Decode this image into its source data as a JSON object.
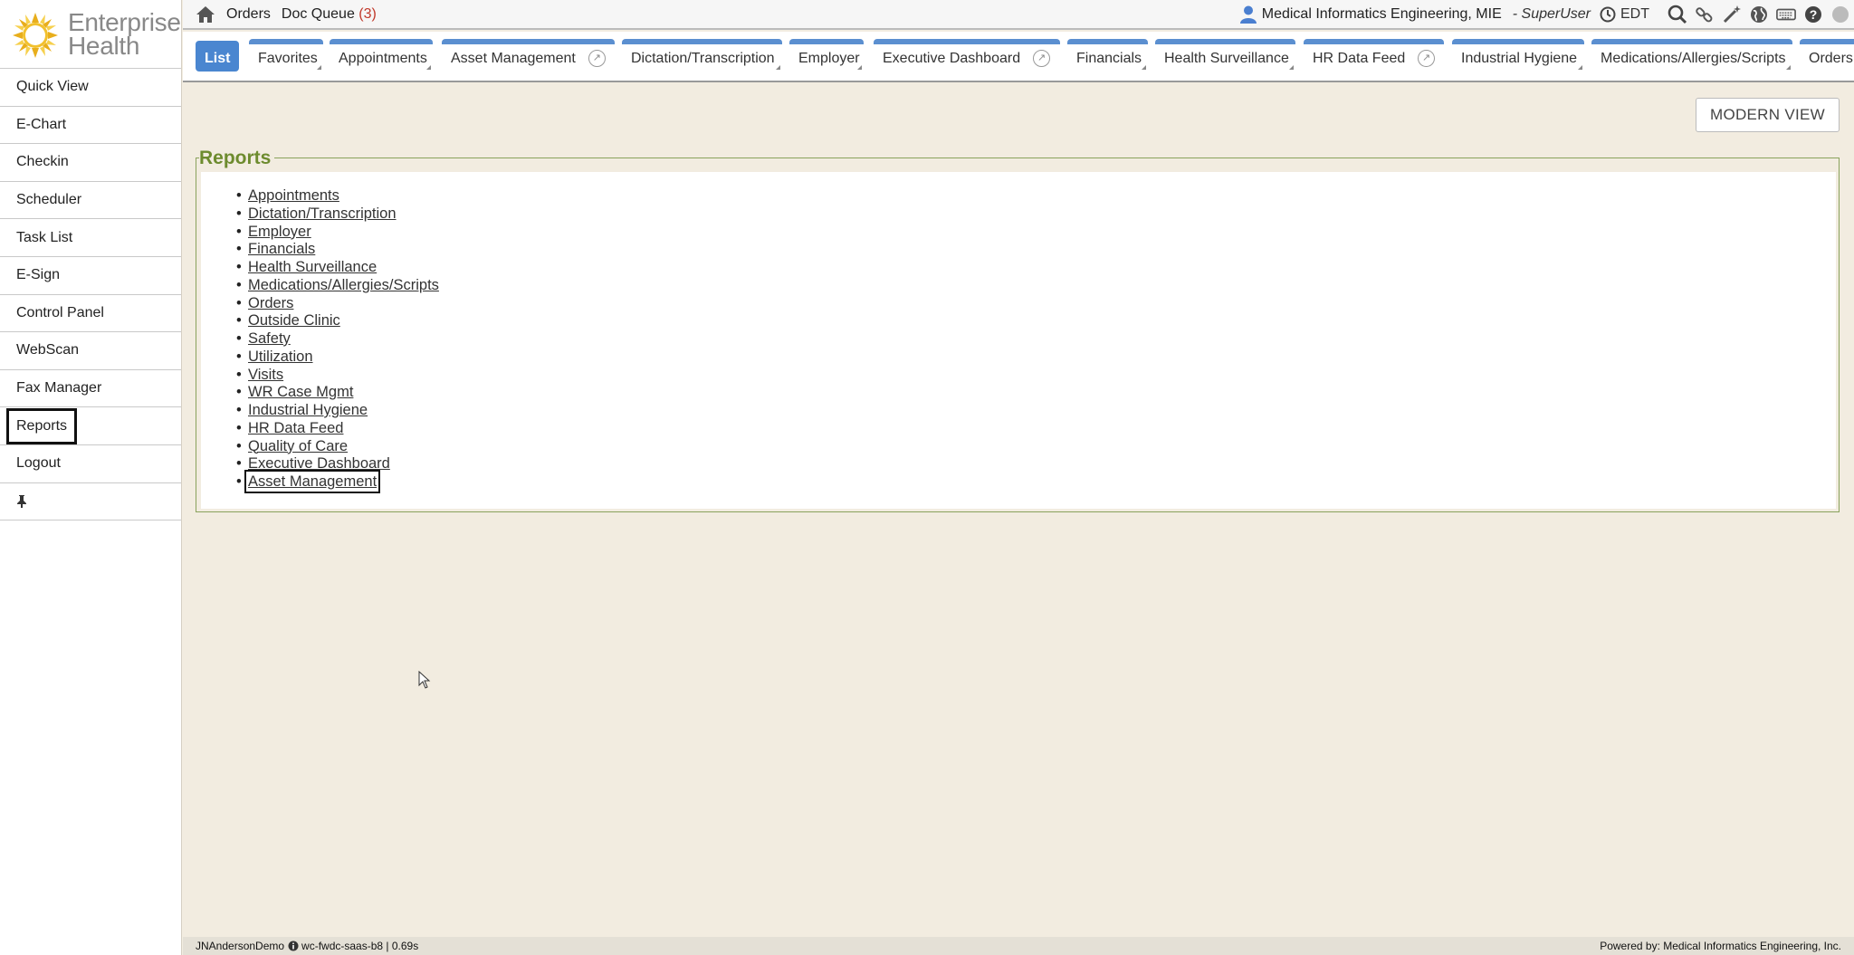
{
  "brand": {
    "line1": "Enterprise",
    "line2": "Health"
  },
  "sidebar": {
    "items": [
      {
        "label": "Quick View"
      },
      {
        "label": "E-Chart"
      },
      {
        "label": "Checkin"
      },
      {
        "label": "Scheduler"
      },
      {
        "label": "Task List"
      },
      {
        "label": "E-Sign"
      },
      {
        "label": "Control Panel"
      },
      {
        "label": "WebScan"
      },
      {
        "label": "Fax Manager"
      },
      {
        "label": "Reports"
      },
      {
        "label": "Logout"
      }
    ],
    "active": "Reports"
  },
  "topbar": {
    "orders": "Orders",
    "doc_queue": "Doc Queue",
    "doc_queue_count": "(3)",
    "user": "Medical Informatics Engineering, MIE",
    "role": "- SuperUser",
    "timezone": "EDT"
  },
  "tabs": [
    {
      "label": "List"
    },
    {
      "label": "Favorites"
    },
    {
      "label": "Appointments"
    },
    {
      "label": "Asset Management"
    },
    {
      "label": "Dictation/Transcription"
    },
    {
      "label": "Employer"
    },
    {
      "label": "Executive Dashboard"
    },
    {
      "label": "Financials"
    },
    {
      "label": "Health Surveillance"
    },
    {
      "label": "HR Data Feed"
    },
    {
      "label": "Industrial Hygiene"
    },
    {
      "label": "Medications/Allergies/Scripts"
    },
    {
      "label": "Orders"
    }
  ],
  "modern_view": "MODERN VIEW",
  "reports": {
    "title": "Reports",
    "items": [
      "Appointments",
      "Dictation/Transcription",
      "Employer",
      "Financials",
      "Health Surveillance",
      "Medications/Allergies/Scripts",
      "Orders",
      "Outside Clinic",
      "Safety",
      "Utilization",
      "Visits",
      "WR Case Mgmt",
      "Industrial Hygiene",
      "HR Data Feed",
      "Quality of Care",
      "Executive Dashboard",
      "Asset Management"
    ]
  },
  "footer": {
    "user": "JNAndersonDemo",
    "server": "wc-fwdc-saas-b8 | 0.69s",
    "powered": "Powered by: Medical Informatics Engineering, Inc."
  },
  "colors": {
    "tab_blue": "#5b8fd0",
    "reports_title": "#6d8b2e",
    "page_bg": "#f2ece0"
  }
}
